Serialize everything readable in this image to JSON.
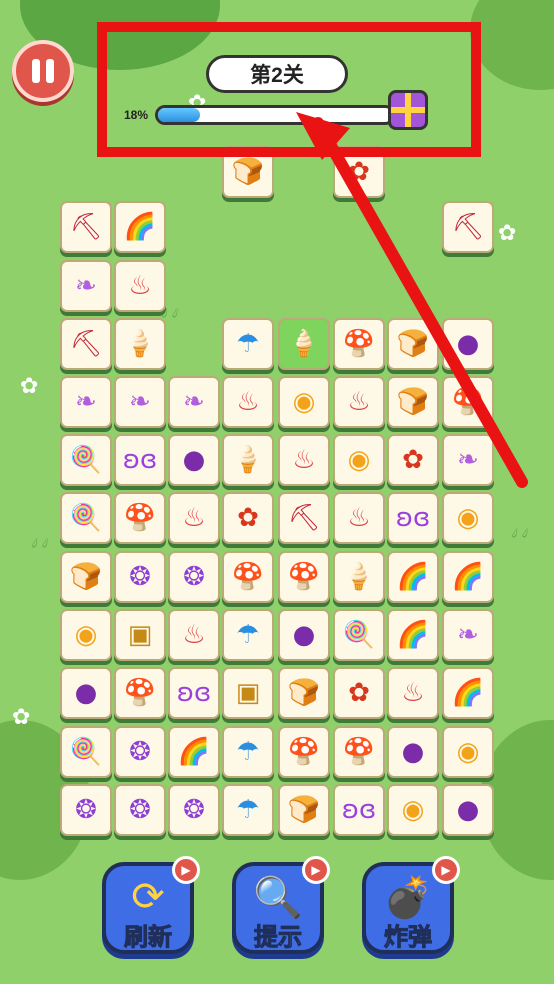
{
  "hud": {
    "level_label": "第2关",
    "progress_label": "18%",
    "progress_fraction": 0.18
  },
  "icons": {
    "shovel": {
      "glyph": "⛏",
      "color": "#c4283c"
    },
    "rainbow": {
      "glyph": "🌈",
      "color": "#2f9e2f"
    },
    "leaf": {
      "glyph": "❧",
      "color": "#b35de0"
    },
    "meat": {
      "glyph": "♨",
      "color": "#e0424a"
    },
    "icecream": {
      "glyph": "🍦",
      "color": "#ef7fa6"
    },
    "umbrella": {
      "glyph": "☂",
      "color": "#2b8fe0"
    },
    "mushroom": {
      "glyph": "🍄",
      "color": "#9b4fd6"
    },
    "bread": {
      "glyph": "🍞",
      "color": "#e2841f"
    },
    "onion": {
      "glyph": "●",
      "color": "#7b2ca8"
    },
    "orange": {
      "glyph": "◉",
      "color": "#f4a21a"
    },
    "maple": {
      "glyph": "✿",
      "color": "#d9361e"
    },
    "lollipop": {
      "glyph": "🍭",
      "color": "#3aa4e8"
    },
    "butterfly": {
      "glyph": "ʚɞ",
      "color": "#9b3fe0"
    },
    "yarn": {
      "glyph": "❂",
      "color": "#8e3ed6"
    },
    "chest": {
      "glyph": "▣",
      "color": "#c58a16"
    }
  },
  "board": [
    [
      "",
      "",
      "",
      "bread",
      "",
      "maple",
      "",
      ""
    ],
    [
      "shovel",
      "rainbow",
      "",
      "",
      "",
      "",
      "",
      "shovel"
    ],
    [
      "leaf",
      "meat",
      "",
      "",
      "",
      "",
      "",
      ""
    ],
    [
      "shovel",
      "icecream",
      "",
      "umbrella",
      "icecream",
      "mushroom",
      "bread",
      "onion"
    ],
    [
      "leaf",
      "leaf",
      "leaf",
      "meat",
      "orange",
      "meat",
      "bread",
      "mushroom"
    ],
    [
      "lollipop",
      "butterfly",
      "onion",
      "icecream",
      "meat",
      "orange",
      "maple",
      "leaf"
    ],
    [
      "lollipop",
      "mushroom",
      "meat",
      "maple",
      "shovel",
      "meat",
      "butterfly",
      "orange"
    ],
    [
      "bread",
      "yarn",
      "yarn",
      "mushroom",
      "mushroom",
      "icecream",
      "rainbow",
      "rainbow"
    ],
    [
      "orange",
      "chest",
      "meat",
      "umbrella",
      "onion",
      "lollipop",
      "rainbow",
      "leaf"
    ],
    [
      "onion",
      "mushroom",
      "butterfly",
      "chest",
      "bread",
      "maple",
      "meat",
      "rainbow"
    ],
    [
      "lollipop",
      "yarn",
      "rainbow",
      "umbrella",
      "mushroom",
      "mushroom",
      "onion",
      "orange"
    ],
    [
      "yarn",
      "yarn",
      "yarn",
      "umbrella",
      "bread",
      "butterfly",
      "orange",
      "onion"
    ]
  ],
  "selected_tile": [
    3,
    4
  ],
  "tools": [
    {
      "id": "refresh",
      "label": "刷新",
      "icon": "refresh-icon",
      "glyph": "⟳"
    },
    {
      "id": "hint",
      "label": "提示",
      "icon": "magnifier-icon",
      "glyph": "🔍"
    },
    {
      "id": "bomb",
      "label": "炸弹",
      "icon": "bomb-icon",
      "glyph": "💣"
    }
  ],
  "colors": {
    "background": "#8fd06b",
    "annotation_red": "#e91313",
    "tool_blue": "#3f6de6"
  }
}
